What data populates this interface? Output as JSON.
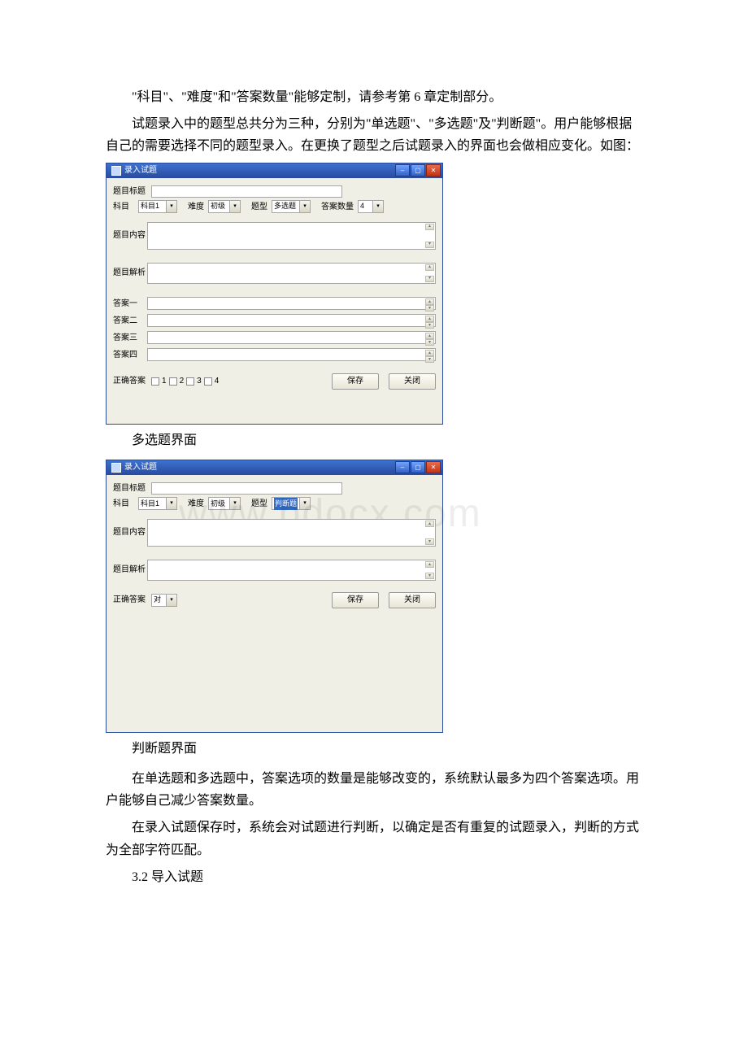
{
  "watermark": "www.bdocx.com",
  "para1": "\"科目\"、\"难度\"和\"答案数量\"能够定制，请参考第 6 章定制部分。",
  "para2": "试题录入中的题型总共分为三种，分别为\"单选题\"、\"多选题\"及\"判断题\"。用户能够根据自己的需要选择不同的题型录入。在更换了题型之后试题录入的界面也会做相应变化。如图：",
  "caption_multi": "多选题界面",
  "caption_judge": "判断题界面",
  "para3": "在单选题和多选题中，答案选项的数量是能够改变的，系统默认最多为四个答案选项。用户能够自己减少答案数量。",
  "para4": "在录入试题保存时，系统会对试题进行判断，以确定是否有重复的试题录入，判断的方式为全部字符匹配。",
  "para5": "3.2 导入试题",
  "win_multi": {
    "title": "录入试题",
    "labels": {
      "title": "题目标题",
      "subject": "科目",
      "difficulty": "难度",
      "type": "题型",
      "ans_count": "答案数量",
      "content": "题目内容",
      "analysis": "题目解析",
      "ans1": "答案一",
      "ans2": "答案二",
      "ans3": "答案三",
      "ans4": "答案四",
      "correct": "正确答案"
    },
    "values": {
      "subject": "科目1",
      "difficulty": "初级",
      "type": "多选题",
      "ans_count": "4",
      "ck_labels": [
        "1",
        "2",
        "3",
        "4"
      ]
    },
    "buttons": {
      "save": "保存",
      "close": "关闭"
    }
  },
  "win_judge": {
    "title": "录入试题",
    "labels": {
      "title": "题目标题",
      "subject": "科目",
      "difficulty": "难度",
      "type": "题型",
      "content": "题目内容",
      "analysis": "题目解析",
      "correct": "正确答案"
    },
    "values": {
      "subject": "科目1",
      "difficulty": "初级",
      "type": "判断题",
      "correct": "对"
    },
    "buttons": {
      "save": "保存",
      "close": "关闭"
    }
  }
}
